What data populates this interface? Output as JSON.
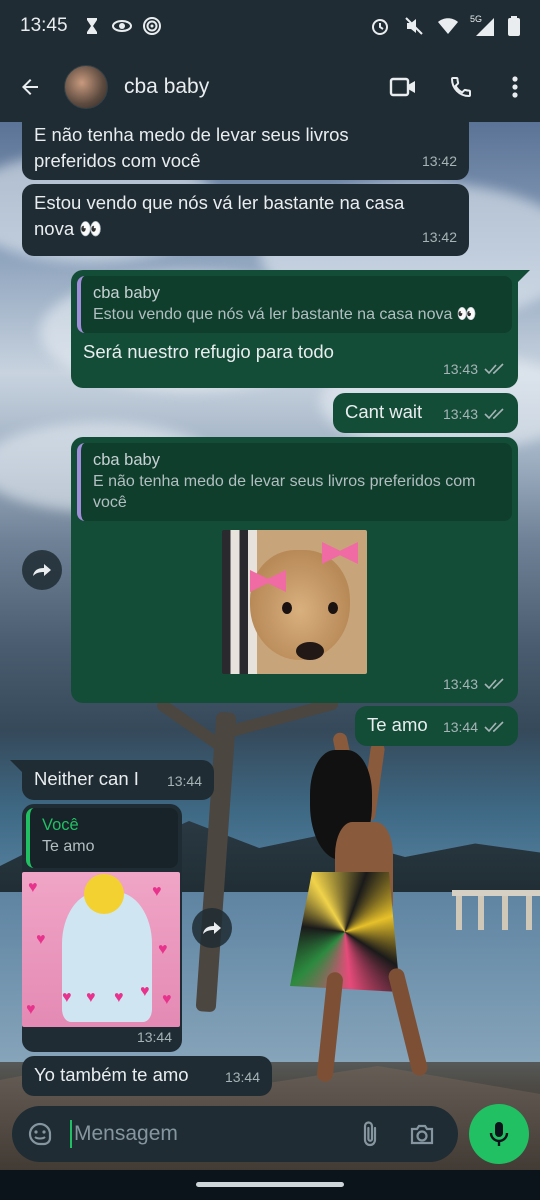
{
  "status_bar": {
    "time": "13:45",
    "left_icons": [
      "hourglass-icon",
      "eye-icon",
      "target-icon"
    ],
    "right_icons": [
      "alarm-icon",
      "mute-icon",
      "wifi-icon",
      "signal-5g-icon",
      "battery-icon"
    ],
    "network_label": "5G"
  },
  "header": {
    "contact_name": "cba baby",
    "actions": [
      "video-call-icon",
      "phone-icon",
      "more-vert-icon"
    ]
  },
  "messages": [
    {
      "id": "m1",
      "direction": "in",
      "text": "E não tenha medo de levar seus livros preferidos com você",
      "time": "13:42"
    },
    {
      "id": "m2",
      "direction": "in",
      "text": "Estou vendo que nós vá ler bastante na casa nova 👀",
      "time": "13:42"
    },
    {
      "id": "m3",
      "direction": "out",
      "quote_author": "cba baby",
      "quote_text": "Estou vendo que nós vá ler bastante na casa nova 👀",
      "text": "Será nuestro refugio para todo",
      "time": "13:43",
      "status": "read"
    },
    {
      "id": "m4",
      "direction": "out",
      "text": "Cant wait",
      "time": "13:43",
      "status": "read"
    },
    {
      "id": "m5",
      "direction": "out",
      "quote_author": "cba baby",
      "quote_text": "E não tenha medo de levar seus livros preferidos com você",
      "sticker": "puppy-with-pink-bows",
      "time": "13:43",
      "status": "read"
    },
    {
      "id": "m6",
      "direction": "out",
      "text": "Te amo",
      "time": "13:44",
      "status": "read"
    },
    {
      "id": "m7",
      "direction": "in",
      "text": "Neither can I",
      "time": "13:44"
    },
    {
      "id": "m8",
      "direction": "in",
      "quote_author": "Você",
      "quote_text": "Te amo",
      "sticker": "homer-with-hearts",
      "time": "13:44"
    },
    {
      "id": "m9",
      "direction": "in",
      "text": "Yo também te amo",
      "time": "13:44"
    }
  ],
  "composer": {
    "placeholder": "Mensagem",
    "icons": [
      "sticker-icon",
      "attach-icon",
      "camera-icon"
    ],
    "send_icon": "mic-icon"
  },
  "colors": {
    "bar_bg": "#1f2c33",
    "incoming_bubble": "#1f2c33",
    "outgoing_bubble": "#144d37",
    "accent_green": "#21c063",
    "quote_bar_purple": "#a18eda"
  }
}
